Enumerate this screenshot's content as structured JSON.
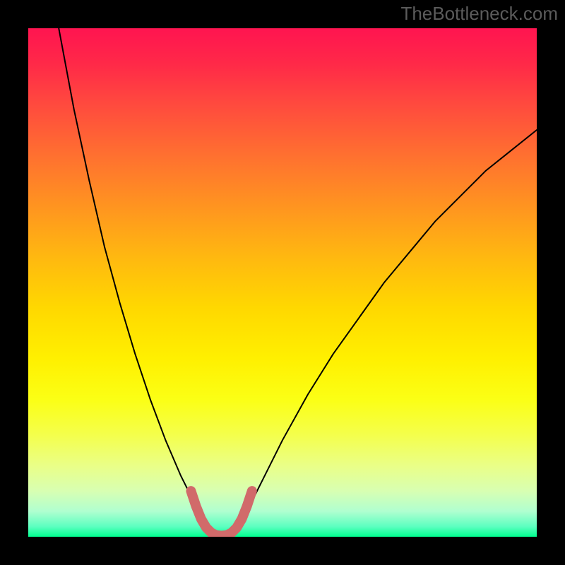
{
  "watermark": "TheBottleneck.com",
  "chart_data": {
    "type": "line",
    "title": "",
    "xlabel": "",
    "ylabel": "",
    "xlim": [
      0,
      100
    ],
    "ylim": [
      0,
      100
    ],
    "grid": false,
    "legend": false,
    "series": [
      {
        "name": "curve-left-arm",
        "stroke": "#000000",
        "stroke_width": 2,
        "x": [
          6,
          9,
          12,
          15,
          18,
          21,
          24,
          27,
          30,
          33,
          35,
          36
        ],
        "y": [
          100,
          84,
          70,
          57,
          46,
          36,
          27,
          19,
          12,
          6,
          2,
          0
        ]
      },
      {
        "name": "curve-right-arm",
        "stroke": "#000000",
        "stroke_width": 2,
        "x": [
          40,
          42,
          45,
          50,
          55,
          60,
          65,
          70,
          75,
          80,
          85,
          90,
          95,
          100
        ],
        "y": [
          0,
          3,
          9,
          19,
          28,
          36,
          43,
          50,
          56,
          62,
          67,
          72,
          76,
          80
        ]
      },
      {
        "name": "bottom-marker",
        "stroke": "#d16a6a",
        "stroke_width": 14,
        "x": [
          32,
          33,
          34,
          35,
          36,
          37,
          38,
          39,
          40,
          41,
          42,
          43,
          44
        ],
        "y": [
          9,
          6,
          3.5,
          1.8,
          0.8,
          0.3,
          0.2,
          0.3,
          0.8,
          1.8,
          3.5,
          6,
          9
        ]
      }
    ],
    "gradient_stops": [
      {
        "pos": 0,
        "color": "#ff1450"
      },
      {
        "pos": 50,
        "color": "#ffd800"
      },
      {
        "pos": 80,
        "color": "#f4ff4c"
      },
      {
        "pos": 100,
        "color": "#00ff90"
      }
    ]
  }
}
